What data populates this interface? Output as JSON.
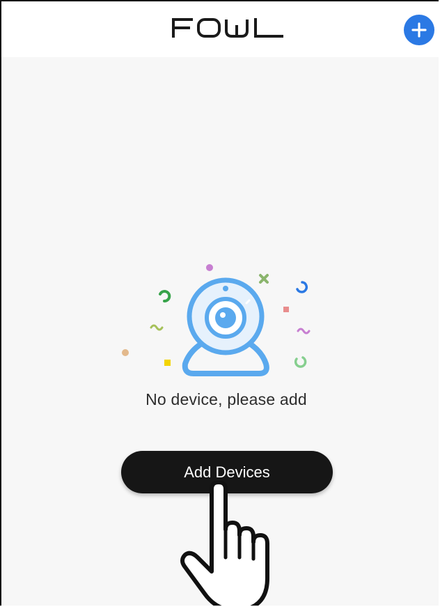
{
  "header": {
    "logo_text": "FOWL",
    "add_button_icon": "plus-icon"
  },
  "empty_state": {
    "illustration_icon": "webcam-icon",
    "message": "No device, please add"
  },
  "actions": {
    "add_devices_label": "Add Devices",
    "pointer_icon": "pointing-hand-icon"
  },
  "colors": {
    "accent": "#2b79e4",
    "button_bg": "#161616",
    "camera_blue": "#5aa9ee",
    "background": "#f7f7f7"
  }
}
